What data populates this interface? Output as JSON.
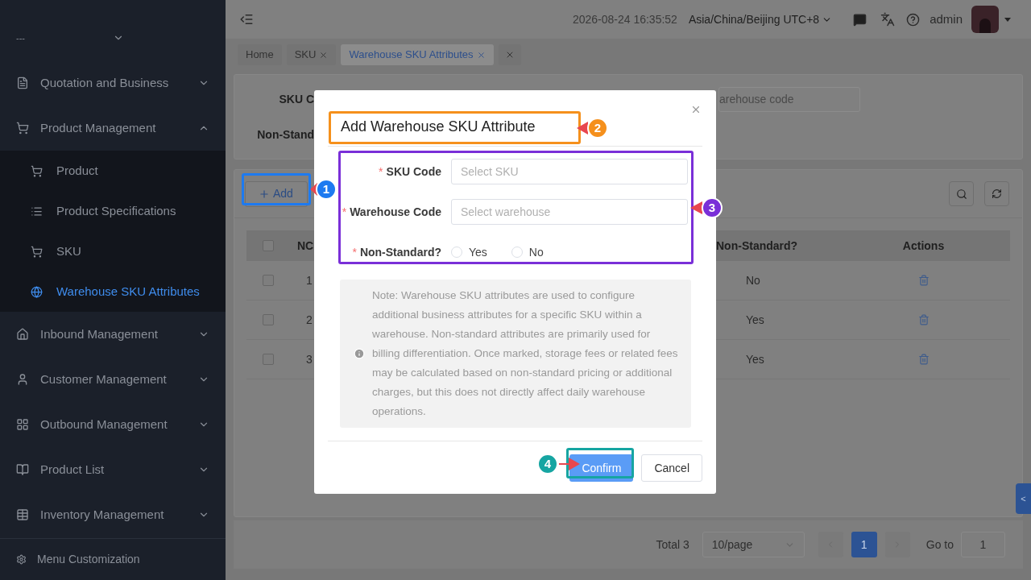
{
  "header": {
    "datetime": "2026-08-24 16:35:52",
    "timezone": "Asia/China/Beijing UTC+8",
    "user": "admin"
  },
  "sidebar": {
    "items": [
      {
        "label": "---",
        "expanded": false
      },
      {
        "label": "Quotation and Business",
        "expanded": false
      },
      {
        "label": "Product Management",
        "expanded": true,
        "children": [
          {
            "label": "Product",
            "selected": false
          },
          {
            "label": "Product Specifications",
            "selected": false
          },
          {
            "label": "SKU",
            "selected": false
          },
          {
            "label": "Warehouse SKU Attributes",
            "selected": true
          }
        ]
      },
      {
        "label": "Inbound Management",
        "expanded": false
      },
      {
        "label": "Customer Management",
        "expanded": false
      },
      {
        "label": "Outbound Management",
        "expanded": false
      },
      {
        "label": "Product List",
        "expanded": false
      },
      {
        "label": "Inventory Management",
        "expanded": false
      }
    ],
    "footer": "Menu Customization"
  },
  "tabs": [
    {
      "kind": "page",
      "label": "Home",
      "closable": false,
      "selected": false
    },
    {
      "kind": "page",
      "label": "SKU",
      "closable": true,
      "selected": false
    },
    {
      "kind": "page",
      "label": "Warehouse SKU Attributes",
      "closable": true,
      "selected": true
    },
    {
      "kind": "close",
      "closable": true,
      "selected": false
    }
  ],
  "filters": {
    "labels": [
      "SKU C",
      "Non-Stand"
    ],
    "field_placeholder": "arehouse code"
  },
  "toolbar": {
    "add_button": "Add"
  },
  "table": {
    "all_checked": false,
    "columns": [
      "NC",
      "Non-Standard?",
      "Actions"
    ],
    "rows": [
      {
        "no": "1",
        "non_standard": "No",
        "checked": false
      },
      {
        "no": "2",
        "non_standard": "Yes",
        "checked": false
      },
      {
        "no": "3",
        "non_standard": "Yes",
        "checked": false
      }
    ]
  },
  "pagination": {
    "total": "Total 3",
    "page_size": "10/page",
    "pages": [
      {
        "label": "1",
        "selected": true
      }
    ],
    "goto_label": "Go to",
    "goto_value": "1"
  },
  "side_tab": "<",
  "dialog": {
    "title": "Add Warehouse SKU Attribute",
    "required_mark": "*",
    "fields": [
      {
        "kind": "select",
        "label": "SKU Code",
        "required": true,
        "placeholder": "Select SKU"
      },
      {
        "kind": "select",
        "label": "Warehouse Code",
        "required": true,
        "placeholder": "Select warehouse"
      },
      {
        "kind": "radio",
        "label": "Non-Standard?",
        "required": true,
        "options": [
          {
            "label": "Yes",
            "selected": false
          },
          {
            "label": "No",
            "selected": false
          }
        ]
      }
    ],
    "note": "Note: Warehouse SKU attributes are used to configure additional business attributes for a specific SKU within a warehouse. Non-standard attributes are primarily used for billing differentiation. Once marked, storage fees or related fees may be calculated based on non-standard pricing or additional charges, but this does not directly affect daily warehouse operations.",
    "buttons": [
      {
        "label": "Confirm",
        "primary": true
      },
      {
        "label": "Cancel",
        "primary": false
      }
    ]
  },
  "annotations": [
    {
      "label": "1",
      "color": "#1d7af0"
    },
    {
      "label": "2",
      "color": "#f5901c"
    },
    {
      "label": "3",
      "color": "#7a2fd8"
    },
    {
      "label": "4",
      "color": "#16a5a2"
    }
  ]
}
